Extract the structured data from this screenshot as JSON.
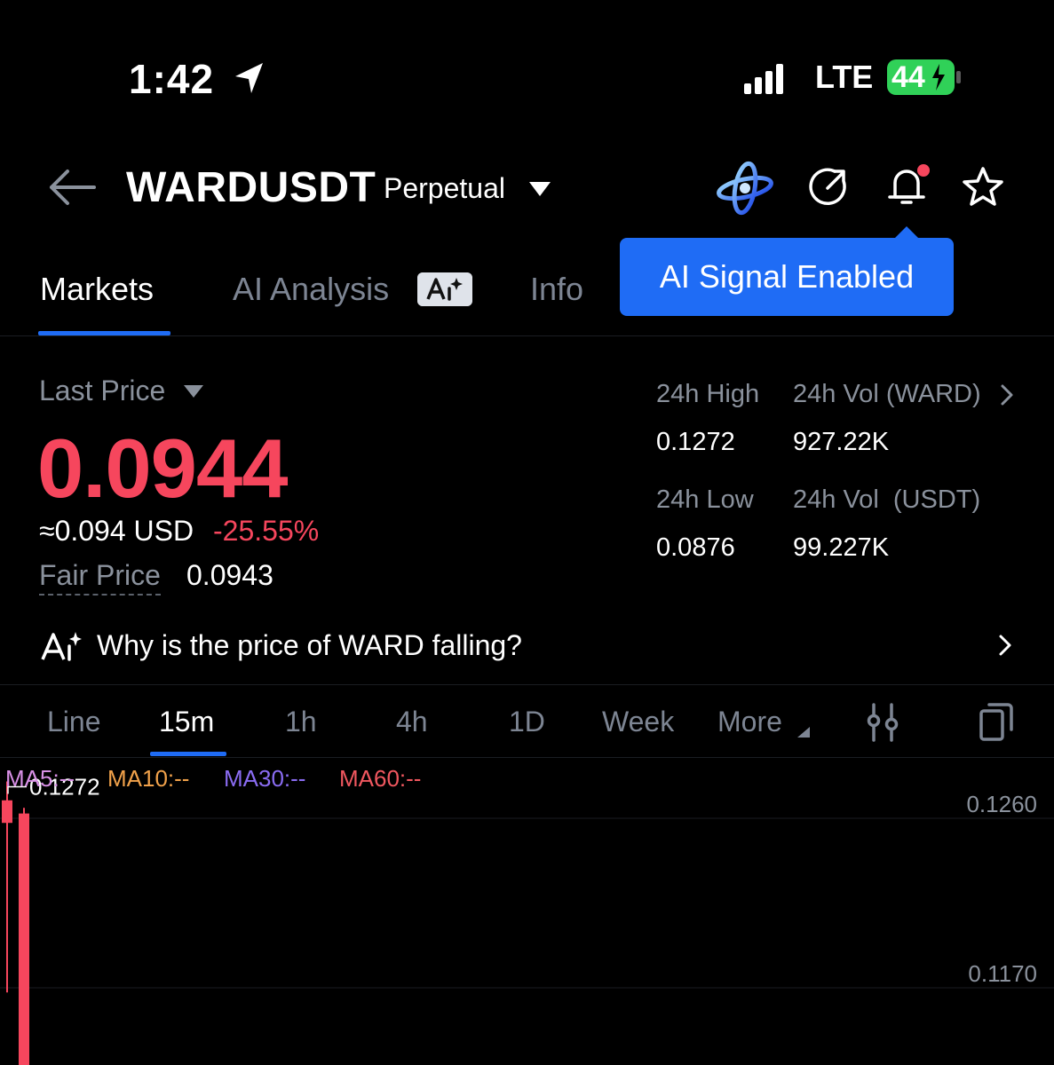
{
  "status_bar": {
    "time": "1:42",
    "network": "LTE",
    "battery": "44"
  },
  "header": {
    "symbol": "WARDUSDT",
    "contract_type": "Perpetual"
  },
  "tooltip": {
    "text": "AI Signal Enabled"
  },
  "tabs": [
    {
      "label": "Markets"
    },
    {
      "label": "AI Analysis"
    },
    {
      "label": "Info"
    }
  ],
  "price": {
    "label": "Last Price",
    "value": "0.0944",
    "approx_usd": "≈0.094 USD",
    "change": "-25.55%",
    "fair_label": "Fair Price",
    "fair_value": "0.0943"
  },
  "stats": {
    "high_label": "24h High",
    "high_value": "0.1272",
    "low_label": "24h Low",
    "low_value": "0.0876",
    "vol_ward_label": "24h Vol (WARD)",
    "vol_ward_value": "927.22K",
    "vol_usdt_label": "24h Vol  (USDT)",
    "vol_usdt_value": "99.227K"
  },
  "ai_question": {
    "text": "Why is the price of WARD falling?"
  },
  "intervals": [
    "Line",
    "15m",
    "1h",
    "4h",
    "1D",
    "Week",
    "More"
  ],
  "ma": [
    {
      "label": "MA5:--",
      "color": "#d890e6"
    },
    {
      "label": "MA10:--",
      "color": "#f0a14a"
    },
    {
      "label": "MA30:--",
      "color": "#8a6cf2"
    },
    {
      "label": "MA60:--",
      "color": "#f0575f"
    }
  ],
  "chart_data": {
    "type": "candlestick",
    "yaxis_ticks": [
      "0.1260",
      "0.1170"
    ],
    "high_marker": "0.1272",
    "candles": [
      {
        "open": 0.1262,
        "close": 0.125,
        "high": 0.1272,
        "low": 0.116,
        "color": "#f6465d"
      },
      {
        "open": 0.1255,
        "close": 0.11,
        "high": 0.1258,
        "low": 0.109,
        "color": "#f6465d"
      }
    ]
  },
  "colors": {
    "accent": "#1f6cf5",
    "down": "#f6465d",
    "muted": "#8a919c"
  }
}
